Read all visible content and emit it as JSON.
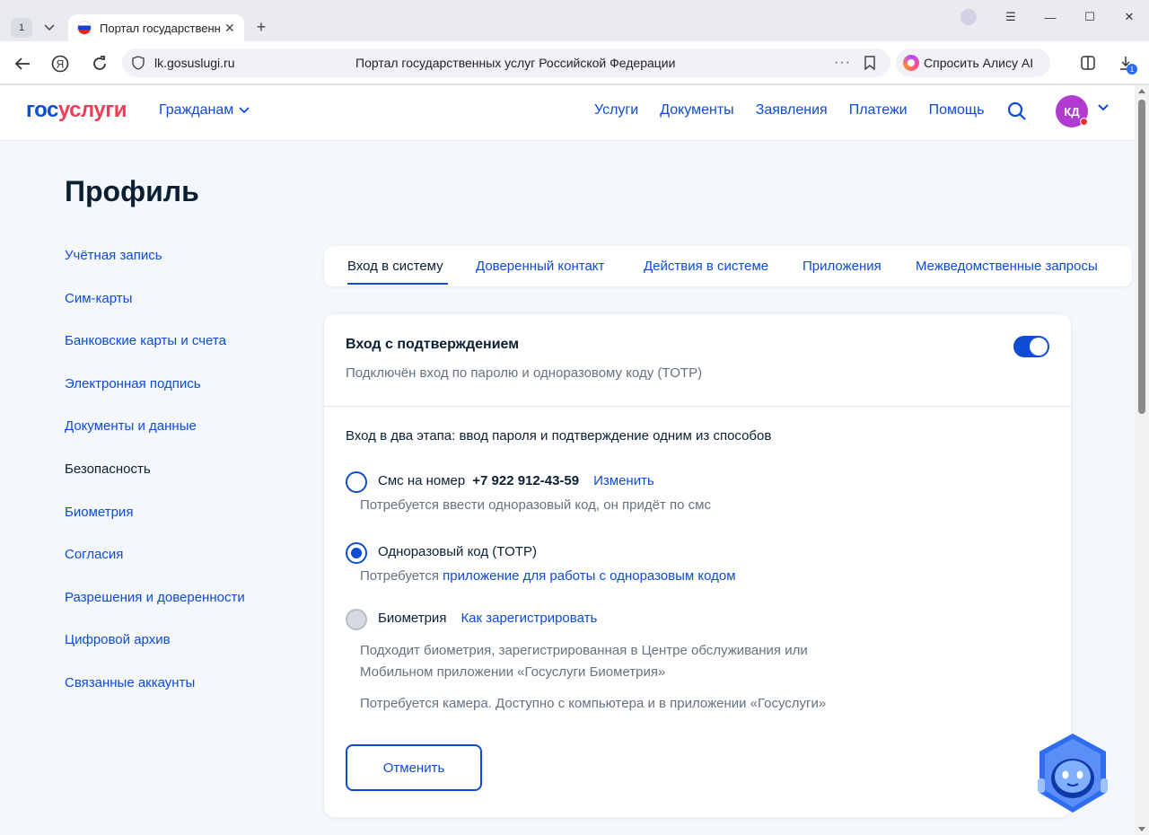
{
  "browser": {
    "tab_count": "1",
    "tab_title": "Портал государственных",
    "url_host": "lk.gosuslugi.ru",
    "page_title": "Портал государственных услуг Российской Федерации",
    "alice_label": "Спросить Алису AI",
    "downloads_badge": "1"
  },
  "header": {
    "logo_gos": "гос",
    "logo_uslugi": "услуги",
    "audience": "Гражданам",
    "nav": [
      "Услуги",
      "Документы",
      "Заявления",
      "Платежи",
      "Помощь"
    ],
    "avatar_initials": "КД"
  },
  "page": {
    "title": "Профиль"
  },
  "sidebar": {
    "items": [
      {
        "label": "Учётная запись"
      },
      {
        "label": "Сим-карты"
      },
      {
        "label": "Банковские карты и счета"
      },
      {
        "label": "Электронная подпись"
      },
      {
        "label": "Документы и данные"
      },
      {
        "label": "Безопасность",
        "active": true
      },
      {
        "label": "Биометрия"
      },
      {
        "label": "Согласия"
      },
      {
        "label": "Разрешения и доверенности"
      },
      {
        "label": "Цифровой архив"
      },
      {
        "label": "Связанные аккаунты"
      }
    ]
  },
  "tabs": [
    {
      "label": "Вход в систему",
      "active": true
    },
    {
      "label": "Доверенный контакт"
    },
    {
      "label": "Действия в системе"
    },
    {
      "label": "Приложения"
    },
    {
      "label": "Межведомственные запросы"
    }
  ],
  "card": {
    "title": "Вход с подтверждением",
    "subtitle": "Подключён вход по паролю и одноразовому коду (TOTP)",
    "toggle_on": true,
    "intro": "Вход в два этапа: ввод пароля и подтверждение одним из способов",
    "options": {
      "sms": {
        "label": "Смс на номер",
        "phone": "+7 922 912-43-59",
        "link": "Изменить",
        "hint": "Потребуется ввести одноразовый код, он придёт по смс",
        "checked": false
      },
      "totp": {
        "label": "Одноразовый код (TOTP)",
        "hint_prefix": "Потребуется",
        "hint_link": "приложение для работы с одноразовым кодом",
        "checked": true
      },
      "biometry": {
        "label": "Биометрия",
        "link": "Как зарегистрировать",
        "hint_line1": "Подходит биометрия, зарегистрированная в Центре обслуживания или",
        "hint_line2": "Мобильном приложении «Госуслуги Биометрия»",
        "hint2": "Потребуется камера. Доступно с компьютера и в приложении «Госуслуги»",
        "disabled": true
      }
    },
    "cancel_label": "Отменить"
  },
  "colors": {
    "brand_blue": "#0d4cd3",
    "brand_red": "#ee3f58",
    "avatar": "#b13ad0",
    "page_bg": "#f4f7fc"
  }
}
